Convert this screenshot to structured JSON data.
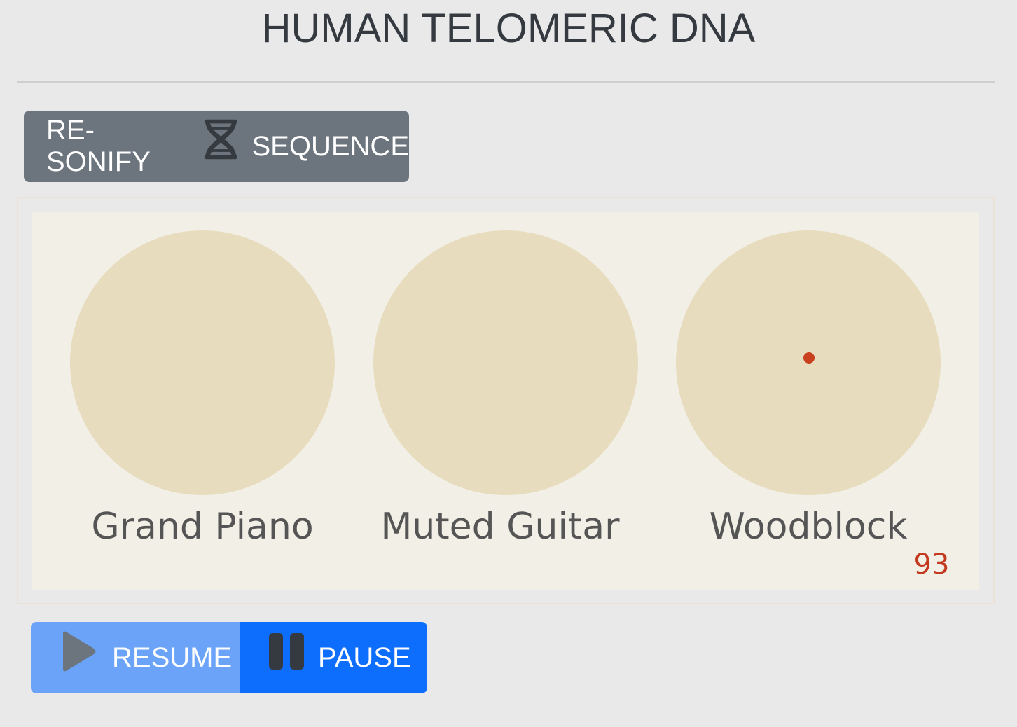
{
  "header": {
    "title": "HUMAN TELOMERIC DNA"
  },
  "actions": {
    "resonify_left": "RE-SONIFY",
    "resonify_icon": "dna-icon",
    "resonify_right": "SEQUENCE"
  },
  "instruments": [
    {
      "label": "Grand Piano"
    },
    {
      "label": "Muted Guitar"
    },
    {
      "label": "Woodblock"
    }
  ],
  "active_note_instrument": "Woodblock",
  "counter": "93",
  "controls": {
    "resume_label": "RESUME",
    "resume_icon": "play-icon",
    "pause_label": "PAUSE",
    "pause_icon": "pause-icon"
  },
  "colors": {
    "background": "#e9e9e9",
    "secondary_button": "#6c757d",
    "primary_button": "#0d6efd",
    "primary_button_disabled": "#6aa3f8",
    "circle": "#e7dcbd",
    "panel": "#f2efe6",
    "note_dot": "#c9401f"
  }
}
